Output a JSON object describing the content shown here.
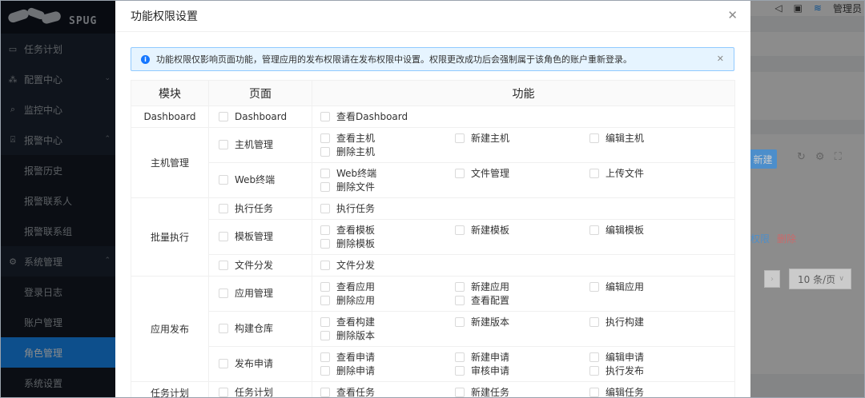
{
  "sidebar": {
    "logo_text": "SPUG",
    "items": [
      {
        "label": "任务计划",
        "icon": "calendar-icon",
        "chev": ""
      },
      {
        "label": "配置中心",
        "icon": "cluster-icon",
        "chev": "⌄"
      },
      {
        "label": "监控中心",
        "icon": "search-icon",
        "chev": ""
      },
      {
        "label": "报警中心",
        "icon": "alarm-icon",
        "chev": "⌃"
      },
      {
        "label": "报警历史",
        "sub": true
      },
      {
        "label": "报警联系人",
        "sub": true
      },
      {
        "label": "报警联系组",
        "sub": true
      },
      {
        "label": "系统管理",
        "icon": "gear-icon",
        "chev": "⌃"
      },
      {
        "label": "登录日志",
        "sub": true
      },
      {
        "label": "账户管理",
        "sub": true
      },
      {
        "label": "角色管理",
        "sub": true,
        "active": true
      },
      {
        "label": "系统设置",
        "sub": true
      }
    ]
  },
  "topbar": {
    "user_label": "管理员"
  },
  "background": {
    "new_button": "新建",
    "link_permission": "权限",
    "link_delete": "删除",
    "page_size": "10 条/页"
  },
  "modal": {
    "title": "功能权限设置",
    "alert": "功能权限仅影响页面功能，管理应用的发布权限请在发布权限中设置。权限更改成功后会强制属于该角色的账户重新登录。",
    "headers": {
      "module": "模块",
      "page": "页面",
      "function": "功能"
    },
    "modules": [
      {
        "name": "Dashboard",
        "pages": [
          {
            "name": "Dashboard",
            "perms": [
              "查看Dashboard"
            ]
          }
        ]
      },
      {
        "name": "主机管理",
        "pages": [
          {
            "name": "主机管理",
            "perms": [
              "查看主机",
              "新建主机",
              "编辑主机",
              "删除主机"
            ]
          },
          {
            "name": "Web终端",
            "perms": [
              "Web终端",
              "文件管理",
              "上传文件",
              "删除文件"
            ]
          }
        ]
      },
      {
        "name": "批量执行",
        "pages": [
          {
            "name": "执行任务",
            "perms": [
              "执行任务"
            ]
          },
          {
            "name": "模板管理",
            "perms": [
              "查看模板",
              "新建模板",
              "编辑模板",
              "删除模板"
            ]
          },
          {
            "name": "文件分发",
            "perms": [
              "文件分发"
            ]
          }
        ]
      },
      {
        "name": "应用发布",
        "pages": [
          {
            "name": "应用管理",
            "perms": [
              "查看应用",
              "新建应用",
              "编辑应用",
              "删除应用",
              "查看配置"
            ]
          },
          {
            "name": "构建仓库",
            "perms": [
              "查看构建",
              "新建版本",
              "执行构建",
              "删除版本"
            ]
          },
          {
            "name": "发布申请",
            "perms": [
              "查看申请",
              "新建申请",
              "编辑申请",
              "删除申请",
              "审核申请",
              "执行发布"
            ]
          }
        ]
      },
      {
        "name": "任务计划",
        "pages": [
          {
            "name": "任务计划",
            "perms": [
              "查看任务",
              "新建任务",
              "编辑任务"
            ]
          }
        ]
      }
    ]
  },
  "colors": {
    "primary": "#1890ff",
    "sidebar_bg": "#1d2533",
    "danger": "#ff4d4f"
  }
}
